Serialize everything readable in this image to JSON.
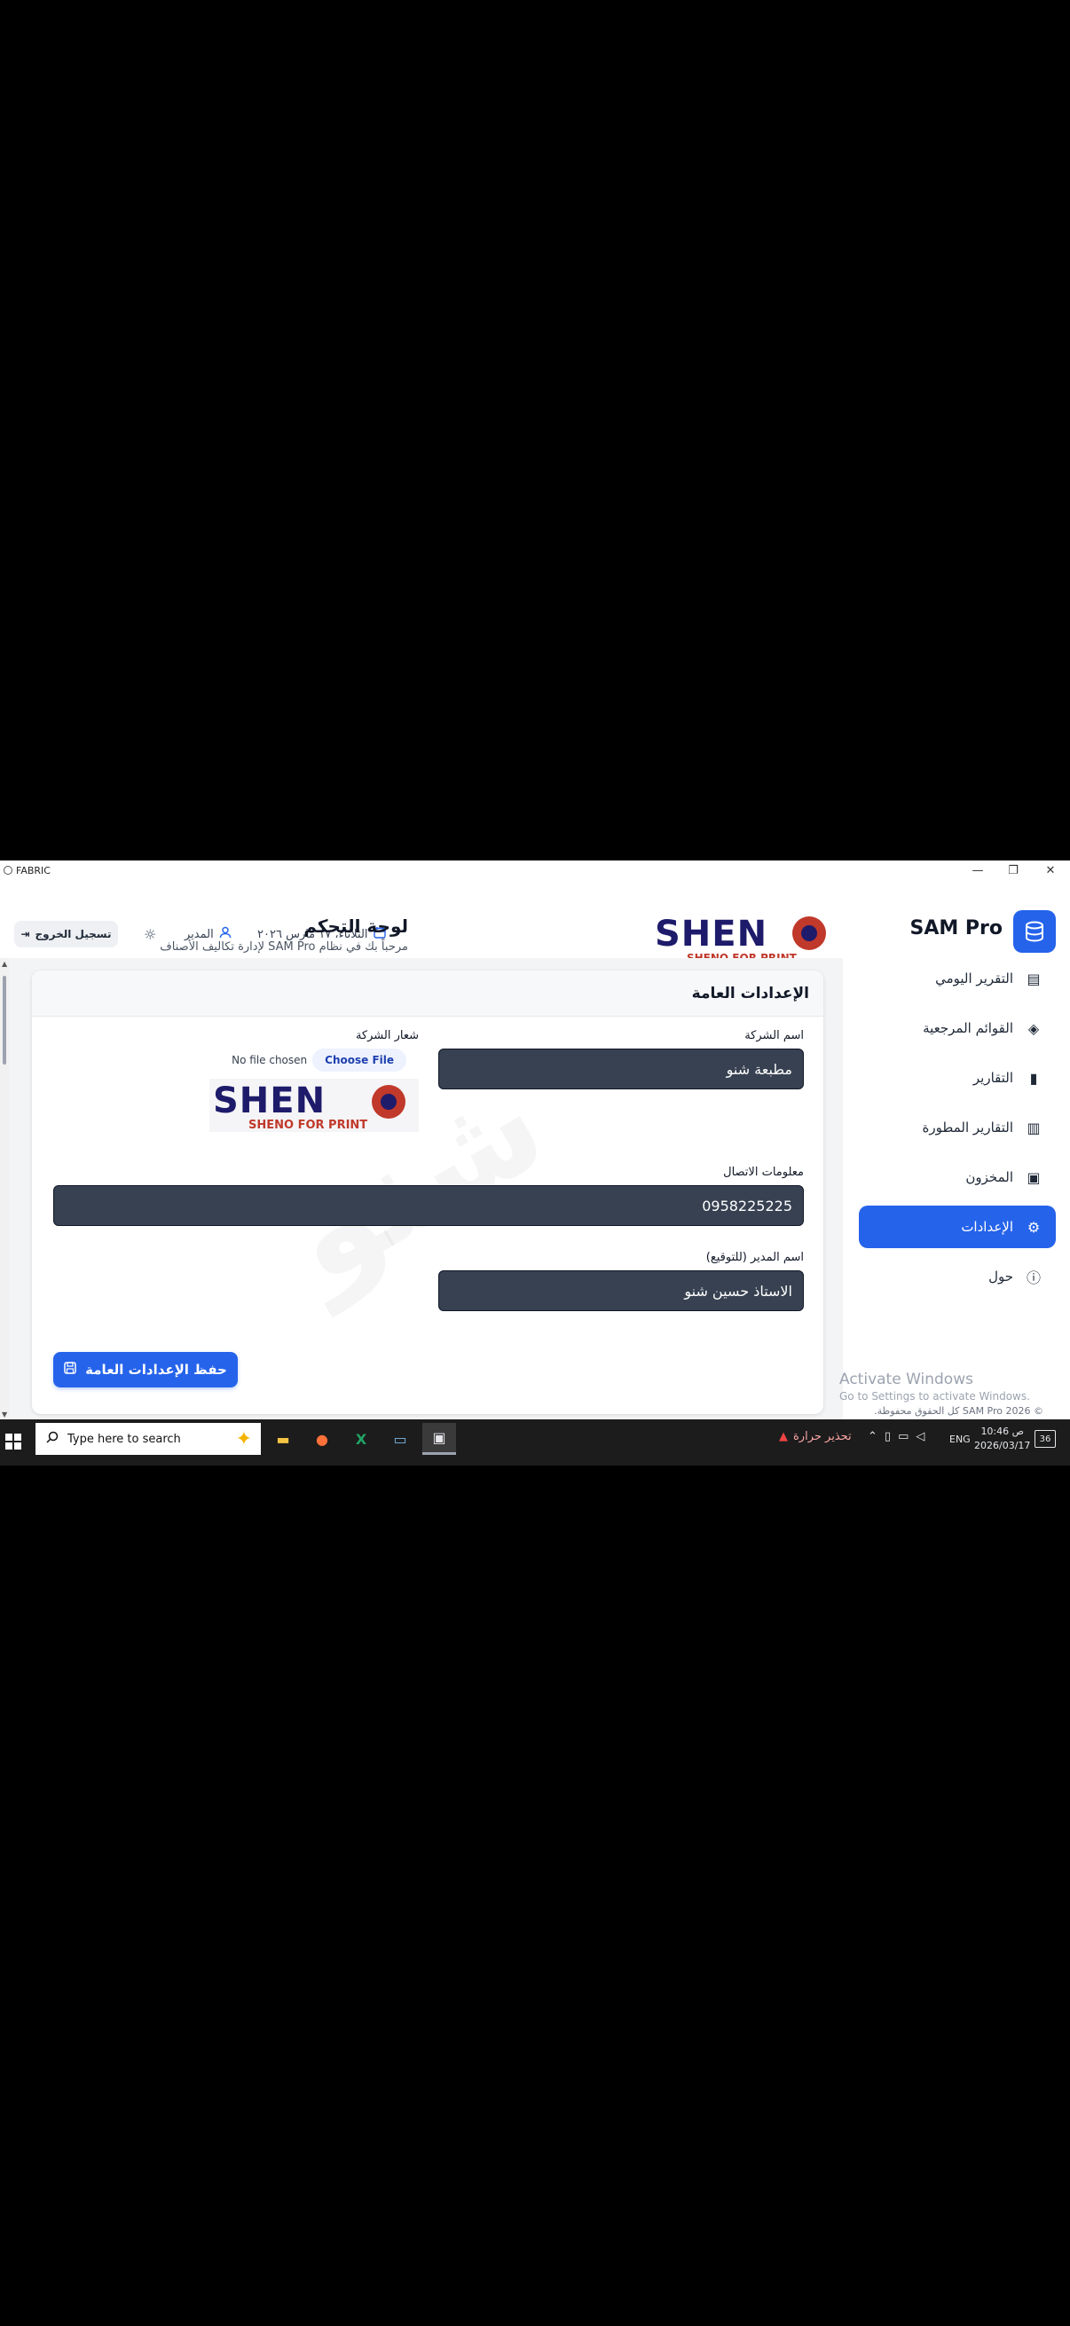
{
  "titlebar": {
    "app_title": "FABRIC",
    "minimize": "—",
    "maximize": "❐",
    "close": "✕"
  },
  "header": {
    "logout_label": "تسجيل الخروج",
    "user_label": "المدير",
    "date_label": "الثلاثاء، ١٧ مارس ٢٠٢٦",
    "page_title": "لوحة التحكم",
    "page_subtitle": "مرحباً بك في نظام SAM Pro لإدارة تكاليف الأصناف",
    "logo_text": "SHENO",
    "logo_sub": "SHENO FOR PRINT"
  },
  "sidebar": {
    "brand": "SAM Pro",
    "items": [
      {
        "label": "التقرير اليومي",
        "icon": "file-icon"
      },
      {
        "label": "القوائم المرجعية",
        "icon": "layers-icon"
      },
      {
        "label": "التقارير",
        "icon": "bar-chart-icon"
      },
      {
        "label": "التقارير المطورة",
        "icon": "chart-icon"
      },
      {
        "label": "المخزون",
        "icon": "archive-icon"
      },
      {
        "label": "الإعدادات",
        "icon": "gear-icon"
      },
      {
        "label": "حول",
        "icon": "info-icon"
      }
    ],
    "active_index": 5
  },
  "settings": {
    "card_title": "الإعدادات العامة",
    "company_name_label": "اسم الشركة",
    "company_name_value": "مطبعة شنو",
    "logo_label": "شعار الشركة",
    "choose_file": "Choose File",
    "no_file": "No file chosen",
    "contact_label": "معلومات الاتصال",
    "contact_value": "0958225225",
    "manager_label": "اسم المدير (للتوقيع)",
    "manager_value": "الاستاذ حسين شنو",
    "save_label": "حفظ الإعدادات العامة"
  },
  "activation": {
    "line1": "Activate Windows",
    "line2": "Go to Settings to activate Windows."
  },
  "copyright": "© SAM Pro 2026 كل الحقوق محفوظة.",
  "taskbar": {
    "search_placeholder": "Type here to search",
    "heat_warning": "تحذير حرارة",
    "lang": "ENG",
    "time": "10:46 ص",
    "date": "2026/03/17",
    "notif_count": "36"
  },
  "colors": {
    "accent": "#2563eb",
    "input_bg": "#374151",
    "logo_navy": "#1e1b6b",
    "logo_red": "#c0392b"
  }
}
